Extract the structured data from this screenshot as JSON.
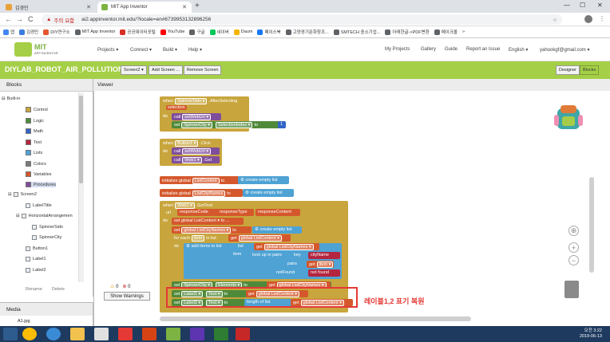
{
  "browser": {
    "tabs": [
      {
        "label": "김경민",
        "favicon_color": "#e9a23b"
      },
      {
        "label": "MIT App Inventor",
        "favicon_color": "#7cb342"
      }
    ],
    "new_tab": "+",
    "window_controls": [
      "—",
      "☐",
      "✕"
    ],
    "nav": {
      "back": "←",
      "forward": "→",
      "reload": "C",
      "home": "⌂"
    },
    "warning_text": "주의 요함",
    "url": "ai2.appinventor.mit.edu/?locale=en#6739953132896256",
    "bookmarks_label": "앱",
    "bookmarks": [
      {
        "label": "김경민",
        "color": "#3b7ddd"
      },
      {
        "label": "DIY연구소",
        "color": "#e4572e"
      },
      {
        "label": "MIT App Inventor",
        "color": "#5f6368"
      },
      {
        "label": "공공데이터포털",
        "color": "#d93025"
      },
      {
        "label": "YouTube",
        "color": "#ff0000"
      },
      {
        "label": "구글",
        "color": "#5f6368"
      },
      {
        "label": "네이버",
        "color": "#03c75a"
      },
      {
        "label": "Daum",
        "color": "#f4b400"
      },
      {
        "label": "페이스북",
        "color": "#1877f2"
      },
      {
        "label": "고양경기문화창조...",
        "color": "#5f6368"
      },
      {
        "label": "SMTECH 중소기업...",
        "color": "#5f6368"
      },
      {
        "label": "아래한글->PDF변환",
        "color": "#5f6368"
      },
      {
        "label": "메이크올",
        "color": "#5f6368"
      }
    ],
    "bookmarks_more": "»"
  },
  "appinventor": {
    "logo_title": "MIT",
    "logo_subtitle": "APP INVENTOR",
    "menus": [
      "Projects ▾",
      "Connect ▾",
      "Build ▾",
      "Help ▾"
    ],
    "right_menus": [
      "My Projects",
      "Gallery",
      "Guide",
      "Report an Issue",
      "English ▾",
      "yahookgf@gmail.com ▾"
    ],
    "project_name": "DIYLAB_ROBOT_AIR_POLLUTION1",
    "screen_select": "Screen2 ▾",
    "add_screen": "Add Screen ...",
    "remove_screen": "Remove Screen",
    "designer": "Designer",
    "blocks_btn": "Blocks"
  },
  "blocks_panel": {
    "title": "Blocks",
    "builtin": "Built-in",
    "builtin_items": [
      {
        "label": "Control",
        "color": "#c8a53d"
      },
      {
        "label": "Logic",
        "color": "#4f8a3a"
      },
      {
        "label": "Math",
        "color": "#3264c8"
      },
      {
        "label": "Text",
        "color": "#b4263f"
      },
      {
        "label": "Lists",
        "color": "#4ea2d4"
      },
      {
        "label": "Colors",
        "color": "#7a7a7a"
      },
      {
        "label": "Variables",
        "color": "#d4582c"
      },
      {
        "label": "Procedures",
        "color": "#7e4d9c"
      }
    ],
    "screen": "Screen2",
    "components": [
      "LabelTitle",
      "HorizontalArrangemen",
      "SpinnerSido",
      "SpinnerCity",
      "Button1",
      "Label1",
      "Label2"
    ],
    "rename": "Rename",
    "delete": "Delete",
    "media_title": "Media",
    "media_item": "A1.jpg"
  },
  "viewer": {
    "title": "Viewer",
    "b1": {
      "when": "when",
      "comp": "SpinnerSido ▾",
      "event": ".AfterSelecting",
      "param": "selection",
      "do": "do",
      "call": "call",
      "proc": "setWebUrl ▾",
      "set": "set",
      "comp2": "SpinnerCity ▾",
      "prop": "SelectionIndex ▾",
      "to": "to",
      "num": "1"
    },
    "b2": {
      "when": "when",
      "comp": "Button1 ▾",
      "event": ".Click",
      "do": "do",
      "call": "call",
      "proc": "setWebUrl ▾",
      "call2": "call",
      "comp2": "Web1 ▾",
      "method": ".Get"
    },
    "b3": {
      "init": "initialize global",
      "name": "ListContent",
      "to": "to",
      "op": "create empty list"
    },
    "b4": {
      "init": "initialize global",
      "name": "ListCityNames",
      "to": "to",
      "op": "create empty list"
    },
    "b5": {
      "when": "when",
      "comp": "Web1 ▾",
      "event": ".GotText",
      "url": "url",
      "p1": "responseCode",
      "p2": "responseType",
      "p3": "responseContent",
      "do": "do",
      "set1": "set global ListContent ▾ to ...",
      "set2": "set",
      "var2": "global ListCityNames ▾",
      "to": "to",
      "op2": "create empty list",
      "foreach": "for each",
      "item": "item",
      "inlist": "in list",
      "get": "get",
      "var3": "global ListContent ▾",
      "do2": "do",
      "additems": "add items to list",
      "list": "list",
      "var4": "global ListCityNames ▾",
      "itemlbl": "item",
      "lookup": "look up in pairs",
      "key": "key",
      "keyval": "cityName",
      "pairs": "pairs",
      "pairsval": "item ▾",
      "notfound": "notFound",
      "nfval": "not found",
      "set3": "set",
      "comp3": "SpinnerCity ▾",
      "prop3": "Elements ▾",
      "var5": "global ListCityNames ▾",
      "set4": "set",
      "comp4": "Label1 ▾",
      "prop4": "Text ▾",
      "var6": "global ListContent ▾",
      "set5": "set",
      "comp5": "Label2 ▾",
      "prop5": "Text ▾",
      "lenlist": "length of list",
      "var7": "global ListContent ▾"
    },
    "warnings": {
      "warn_count": "0",
      "err_count": "0",
      "show": "Show Warnings"
    },
    "annotation": "레이블1,2 표기 복원",
    "zoom": {
      "center": "⊕",
      "plus": "+",
      "minus": "−"
    }
  },
  "taskbar": {
    "time": "오전 3:22",
    "date": "2019-06-13",
    "icons": [
      "start",
      "chrome",
      "ie",
      "explorer",
      "app1",
      "app2",
      "app3",
      "app4",
      "app5",
      "app6",
      "app7"
    ]
  }
}
